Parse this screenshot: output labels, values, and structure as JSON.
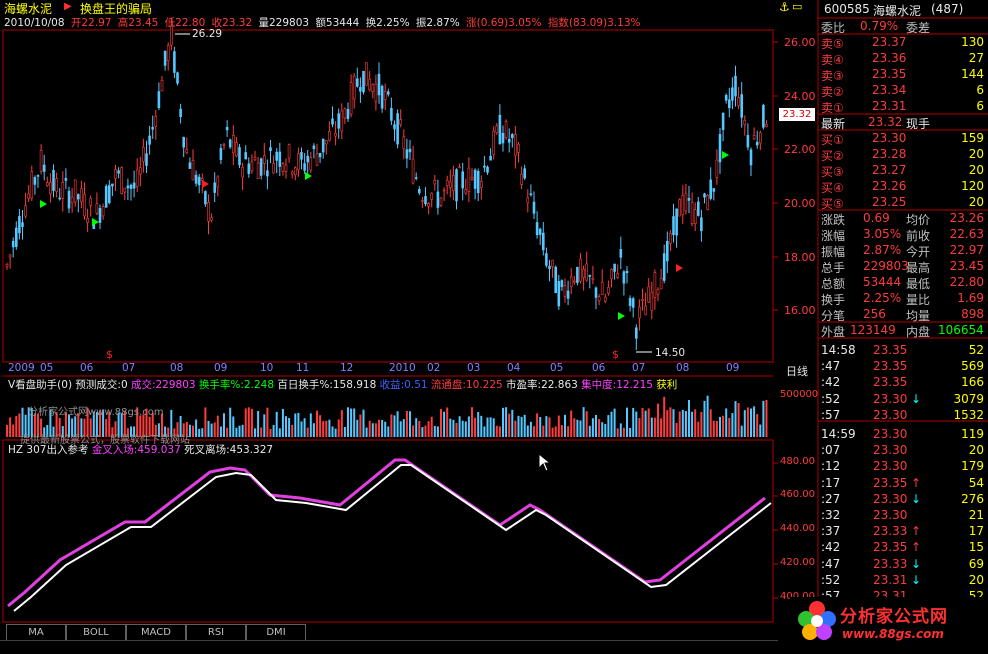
{
  "header": {
    "stock_name": "海螺水泥",
    "indicator_name": "换盘王的骗局"
  },
  "ohlc_line": {
    "date": "2010/10/08",
    "open": "开22.97",
    "high": "高23.45",
    "low": "低22.80",
    "close": "收23.32",
    "volume": "量229803",
    "amount": "额53444",
    "turnover": "换2.25%",
    "amplitude": "振2.87%",
    "change": "涨(0.69)3.05%",
    "index": "指数(83.09)3.13%"
  },
  "price_axis": [
    "26.00",
    "24.00",
    "22.00",
    "20.00",
    "18.00",
    "16.00"
  ],
  "price_current_tag": "23.32",
  "price_high_label": "26.29",
  "price_low_label": "14.50",
  "time_axis": [
    "2009",
    "05",
    "06",
    "07",
    "08",
    "09",
    "10",
    "11",
    "12",
    "2010",
    "02",
    "03",
    "04",
    "05",
    "06",
    "07",
    "08",
    "09"
  ],
  "period_button": "日线",
  "volume_panel": {
    "title": "V看盘助手(0)",
    "predict": "预测成交:0",
    "deal": "成交:229803",
    "turn_rate": "换手率%:2.248",
    "hundred_day": "百日换手%:158.918",
    "earning": "收益:0.51",
    "float_cap": "流通盘:10.225",
    "pe": "市盈率:22.863",
    "concentration": "集中度:12.215",
    "profit": "获利",
    "axis_value": "500000",
    "watermark1": "分析家公式网www.88gs.com",
    "watermark2": "提供最新股票公式，股票软件下载网站"
  },
  "indicator_panel": {
    "title": "HZ 307出入参考",
    "golden": "金叉入场:459.037",
    "death": "死叉离场:453.327",
    "axis": [
      "480.00",
      "460.00",
      "440.00",
      "420.00",
      "400.00"
    ]
  },
  "tabs": [
    "MA",
    "BOLL",
    "MACD",
    "RSI",
    "DMI"
  ],
  "right_panel": {
    "code": "600585",
    "name": "海螺水泥",
    "count": "(487)",
    "weibi_label": "委比",
    "weibi_value": "0.79%",
    "weicha_label": "委差",
    "sell": [
      {
        "label": "卖⑤",
        "price": "23.37",
        "vol": "130"
      },
      {
        "label": "卖④",
        "price": "23.36",
        "vol": "27"
      },
      {
        "label": "卖③",
        "price": "23.35",
        "vol": "144"
      },
      {
        "label": "卖②",
        "price": "23.34",
        "vol": "6"
      },
      {
        "label": "卖①",
        "price": "23.31",
        "vol": "6"
      }
    ],
    "latest_label": "最新",
    "latest_value": "23.32",
    "xianshou": "现手",
    "buy": [
      {
        "label": "买①",
        "price": "23.30",
        "vol": "159"
      },
      {
        "label": "买②",
        "price": "23.28",
        "vol": "20"
      },
      {
        "label": "买③",
        "price": "23.27",
        "vol": "20"
      },
      {
        "label": "买④",
        "price": "23.26",
        "vol": "120"
      },
      {
        "label": "买⑤",
        "price": "23.25",
        "vol": "20"
      }
    ],
    "stats": [
      {
        "l1": "涨跌",
        "v1": "0.69",
        "l2": "均价",
        "v2": "23.26"
      },
      {
        "l1": "涨幅",
        "v1": "3.05%",
        "l2": "前收",
        "v2": "22.63"
      },
      {
        "l1": "振幅",
        "v1": "2.87%",
        "l2": "今开",
        "v2": "22.97"
      },
      {
        "l1": "总手",
        "v1": "229803",
        "l2": "最高",
        "v2": "23.45"
      },
      {
        "l1": "总额",
        "v1": "53444",
        "l2": "最低",
        "v2": "22.80"
      },
      {
        "l1": "换手",
        "v1": "2.25%",
        "l2": "量比",
        "v2": "1.69"
      },
      {
        "l1": "分笔",
        "v1": "256",
        "l2": "均量",
        "v2": "898"
      }
    ],
    "waipan_label": "外盘",
    "waipan_value": "123149",
    "neipan_label": "内盘",
    "neipan_value": "106654",
    "ticks": [
      {
        "t": "14:58",
        "p": "23.35",
        "a": "",
        "v": "52"
      },
      {
        "t": ":47",
        "p": "23.35",
        "a": "",
        "v": "569"
      },
      {
        "t": ":42",
        "p": "23.35",
        "a": "",
        "v": "166"
      },
      {
        "t": ":52",
        "p": "23.30",
        "a": "↓",
        "v": "3079"
      },
      {
        "t": ":57",
        "p": "23.30",
        "a": "",
        "v": "1532"
      },
      {
        "t": "14:59",
        "p": "23.30",
        "a": "",
        "v": "119"
      },
      {
        "t": ":07",
        "p": "23.30",
        "a": "",
        "v": "20"
      },
      {
        "t": ":12",
        "p": "23.30",
        "a": "",
        "v": "179"
      },
      {
        "t": ":17",
        "p": "23.35",
        "a": "↑",
        "v": "54"
      },
      {
        "t": ":27",
        "p": "23.30",
        "a": "↓",
        "v": "276"
      },
      {
        "t": ":32",
        "p": "23.30",
        "a": "",
        "v": "21"
      },
      {
        "t": ":37",
        "p": "23.33",
        "a": "↑",
        "v": "17"
      },
      {
        "t": ":42",
        "p": "23.35",
        "a": "↑",
        "v": "15"
      },
      {
        "t": ":47",
        "p": "23.33",
        "a": "↓",
        "v": "69"
      },
      {
        "t": ":52",
        "p": "23.31",
        "a": "↓",
        "v": "20"
      },
      {
        "t": ":57",
        "p": "23.31",
        "a": "",
        "v": "52"
      }
    ]
  },
  "logo": {
    "text": "分析家公式网",
    "url": "www.88gs.com"
  }
}
